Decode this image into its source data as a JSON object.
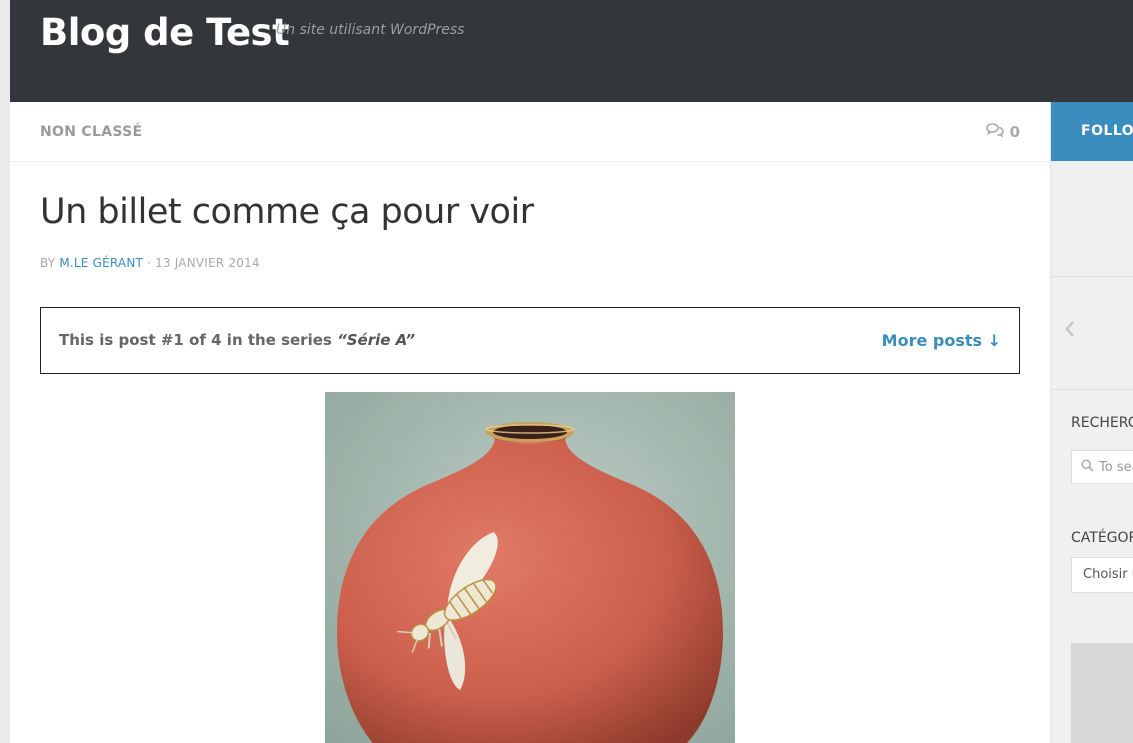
{
  "site": {
    "title": "Blog de Test",
    "tagline": "Un site utilisant WordPress"
  },
  "post_bar": {
    "category": "NON CLASSÉ",
    "comments_count": "0"
  },
  "sidebar": {
    "follow_label": "FOLLOW",
    "search_label": "RECHERCHE",
    "search_placeholder": "To search",
    "categories_label": "CATÉGORIES",
    "categories_select_value": "Choisir une catégorie"
  },
  "post": {
    "title": "Un billet comme ça pour voir",
    "by_prefix": "BY ",
    "author": "M.LE GÉRANT",
    "separator": " · ",
    "date": "13 JANVIER 2014",
    "series_intro": "This is post #1 of 4 in the series ",
    "series_name": "“Série A”",
    "more_posts": "More posts ↓"
  },
  "colors": {
    "header_bg": "#33363b",
    "accent": "#3b8dbd"
  },
  "icons": [
    "comments-icon",
    "chevron-left-icon",
    "search-icon"
  ]
}
